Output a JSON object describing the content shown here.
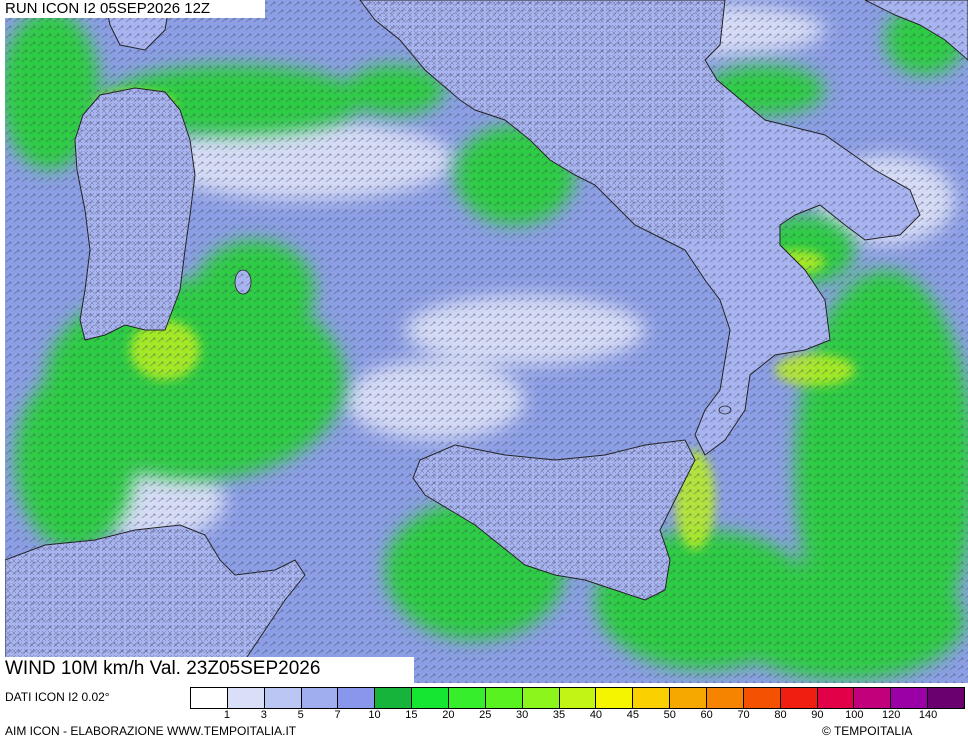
{
  "header": {
    "run": "RUN ICON I2 05SEP2026 12Z"
  },
  "variable": {
    "label": "WIND 10M km/h Val. 23Z05SEP2026"
  },
  "footer": {
    "data_source": "DATI ICON I2 0.02°",
    "elaboration": "AIM ICON - ELABORAZIONE WWW.TEMPOITALIA.IT",
    "copyright": "© TEMPOITALIA"
  },
  "legend": {
    "ticks": [
      "1",
      "3",
      "5",
      "7",
      "10",
      "15",
      "20",
      "25",
      "30",
      "35",
      "40",
      "45",
      "50",
      "60",
      "70",
      "80",
      "90",
      "100",
      "120",
      "140"
    ],
    "colors": [
      "#ffffff",
      "#d9dff7",
      "#bcc6f4",
      "#a0aef0",
      "#8896ec",
      "#16b43a",
      "#14e632",
      "#37ee2c",
      "#57f21f",
      "#8cf51c",
      "#c2f513",
      "#f6f500",
      "#fbd000",
      "#f7a800",
      "#f78400",
      "#f45200",
      "#f01e10",
      "#e20048",
      "#c2007c",
      "#9a00a6",
      "#6a0070"
    ]
  },
  "map": {
    "sea_color": "#8c9ee4",
    "land_color": "#a8b4ef",
    "calm_color": "#eef0fb",
    "breeze_color": "#2ecc45",
    "strong_color": "#b8ee22"
  }
}
